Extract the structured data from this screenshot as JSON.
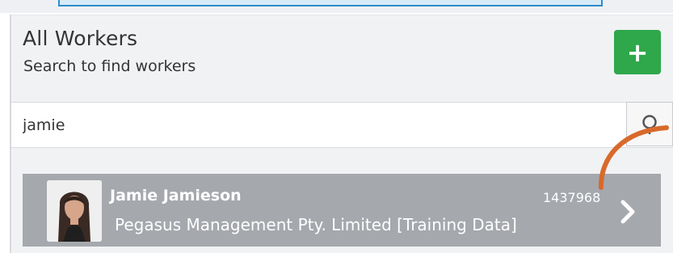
{
  "header": {
    "title": "All Workers",
    "subtitle": "Search to find workers",
    "add_button_label": "+"
  },
  "search": {
    "value": "jamie",
    "button_icon": "search-icon"
  },
  "results": [
    {
      "name": "Jamie Jamieson",
      "id": "1437968",
      "company": "Pegasus Management Pty. Limited [Training Data]",
      "avatar": "avatar-photo",
      "action_icon": "chevron-right-icon"
    }
  ],
  "colors": {
    "accent_green": "#2ea84a",
    "row_gray": "#a5a8ad",
    "annotation_orange": "#d86a2b",
    "top_bar_blue": "#2d8ccc"
  }
}
